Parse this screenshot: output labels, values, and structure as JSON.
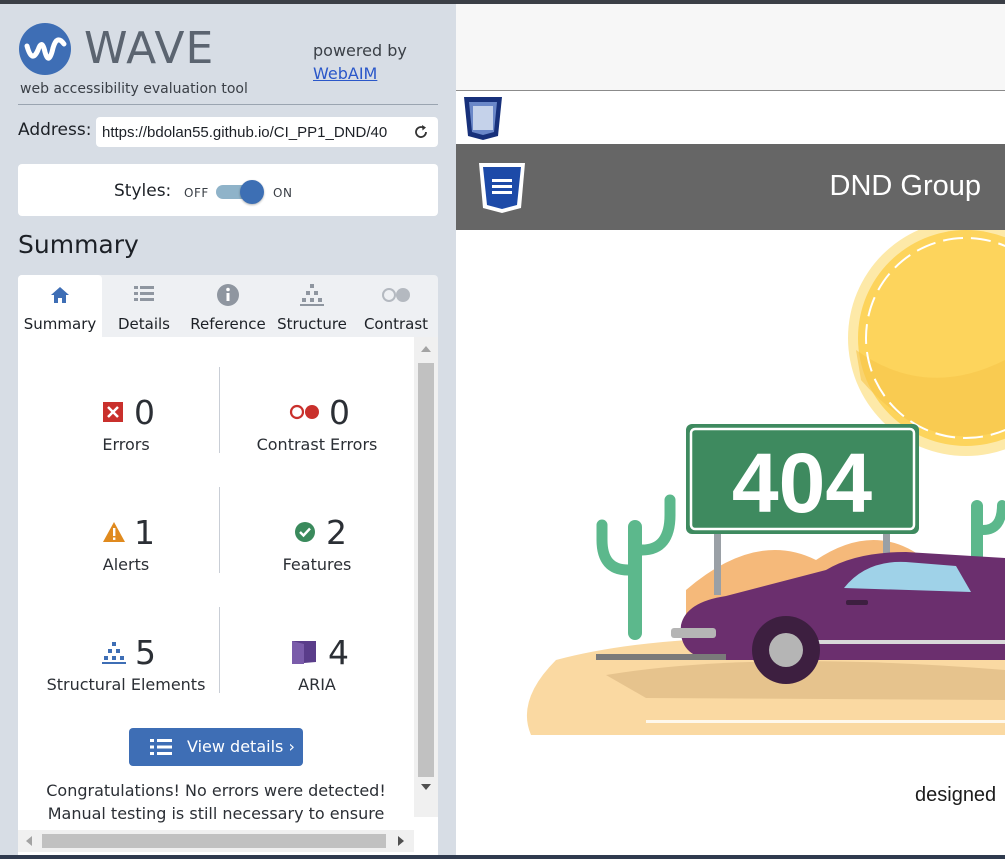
{
  "wave": {
    "brand": "WAVE",
    "tagline": "web accessibility evaluation tool",
    "powered_by": "powered by",
    "webaim_link": "WebAIM"
  },
  "address": {
    "label": "Address:",
    "value": "https://bdolan55.github.io/CI_PP1_DND/40"
  },
  "styles": {
    "label": "Styles:",
    "off": "OFF",
    "on": "ON",
    "state": "on"
  },
  "summary": {
    "heading": "Summary",
    "tabs": [
      {
        "label": "Summary",
        "icon": "home-icon",
        "active": true
      },
      {
        "label": "Details",
        "icon": "list-icon",
        "active": false
      },
      {
        "label": "Reference",
        "icon": "info-icon",
        "active": false
      },
      {
        "label": "Structure",
        "icon": "hierarchy-icon",
        "active": false
      },
      {
        "label": "Contrast",
        "icon": "contrast-icon",
        "active": false
      }
    ],
    "stats": {
      "errors": {
        "count": "0",
        "label": "Errors",
        "icon": "error-icon",
        "color": "#c9302c"
      },
      "contrast_errors": {
        "count": "0",
        "label": "Contrast Errors",
        "icon": "contrast-error-icon",
        "color": "#c9302c"
      },
      "alerts": {
        "count": "1",
        "label": "Alerts",
        "icon": "alert-icon",
        "color": "#e08a1e"
      },
      "features": {
        "count": "2",
        "label": "Features",
        "icon": "feature-icon",
        "color": "#3a8a5c"
      },
      "structural": {
        "count": "5",
        "label": "Structural Elements",
        "icon": "structure-icon",
        "color": "#3e6eb5"
      },
      "aria": {
        "count": "4",
        "label": "ARIA",
        "icon": "aria-icon",
        "color": "#5a3d8a"
      }
    },
    "view_details": "View details ›",
    "congrats_line1": "Congratulations! No errors were detected!",
    "congrats_line2": "Manual testing is still necessary to ensure"
  },
  "preview": {
    "site_title": "DND Group",
    "sign_text": "404",
    "footer_text": "designed"
  },
  "colors": {
    "sidebar_bg": "#d7dde5",
    "accent_blue": "#3e6eb5",
    "header_gray": "#666666",
    "sign_green": "#3e8a5f"
  }
}
